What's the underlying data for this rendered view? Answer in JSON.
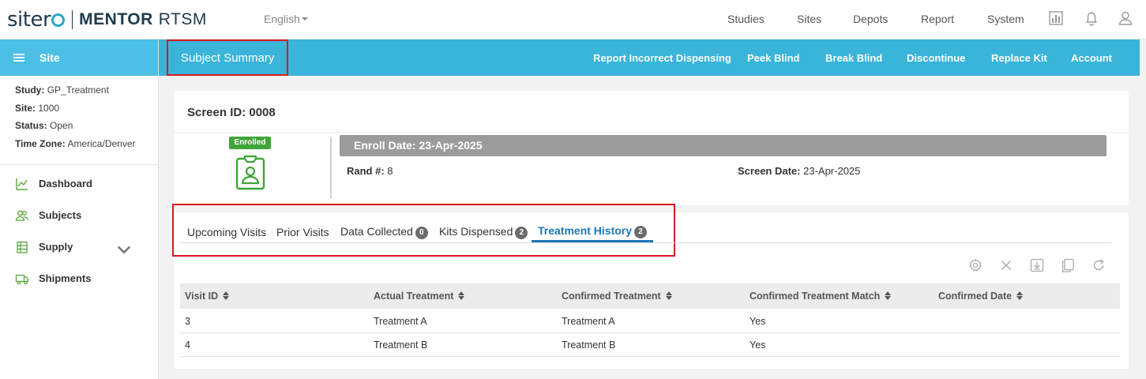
{
  "app": {
    "logo_brand": "sitero",
    "logo_product_bold": "MENTOR",
    "logo_product": "RTSM",
    "language": "English"
  },
  "topnav": [
    "Studies",
    "Sites",
    "Depots",
    "Report",
    "System"
  ],
  "top_icons": [
    "reports-icon",
    "bell-icon",
    "user-icon"
  ],
  "sidebar": {
    "header": "Site",
    "info": [
      {
        "label": "Study:",
        "value": "GP_Treatment"
      },
      {
        "label": "Site:",
        "value": "1000"
      },
      {
        "label": "Status:",
        "value": "Open"
      },
      {
        "label": "Time Zone:",
        "value": "America/Denver"
      }
    ],
    "items": [
      {
        "label": "Dashboard",
        "icon": "chart-icon"
      },
      {
        "label": "Subjects",
        "icon": "users-icon"
      },
      {
        "label": "Supply",
        "icon": "supply-icon",
        "expandable": true
      },
      {
        "label": "Shipments",
        "icon": "truck-icon"
      }
    ]
  },
  "subheader": {
    "title": "Subject Summary",
    "actions": [
      "Report Incorrect Dispensing",
      "Peek Blind",
      "Break Blind",
      "Discontinue",
      "Replace Kit",
      "Account"
    ]
  },
  "subject": {
    "screen_id": "Screen ID: 0008",
    "status_badge": "Enrolled",
    "enroll_date": "Enroll Date: 23-Apr-2025",
    "rand_label": "Rand #:",
    "rand_value": "8",
    "screen_date_label": "Screen Date:",
    "screen_date_value": "23-Apr-2025"
  },
  "tabs": [
    {
      "label": "Upcoming Visits"
    },
    {
      "label": "Prior Visits"
    },
    {
      "label": "Data Collected",
      "count": "0"
    },
    {
      "label": "Kits Dispensed",
      "count": "2"
    },
    {
      "label": "Treatment History",
      "count": "2",
      "active": true
    }
  ],
  "toolbar_icons": [
    "settings-icon",
    "clear-icon",
    "download-icon",
    "copy-icon",
    "refresh-icon"
  ],
  "table": {
    "columns": [
      "Visit ID",
      "Actual Treatment",
      "Confirmed Treatment",
      "Confirmed Treatment Match",
      "Confirmed Date"
    ],
    "rows": [
      [
        "3",
        "Treatment A",
        "Treatment A",
        "Yes",
        ""
      ],
      [
        "4",
        "Treatment B",
        "Treatment B",
        "Yes",
        ""
      ]
    ]
  },
  "colors": {
    "accent": "#3ab4d8",
    "sidebar_header": "#4bc0e4",
    "active_tab": "#1a78b8",
    "enrolled_badge": "#3ea637",
    "highlight_box": "#d71920"
  }
}
